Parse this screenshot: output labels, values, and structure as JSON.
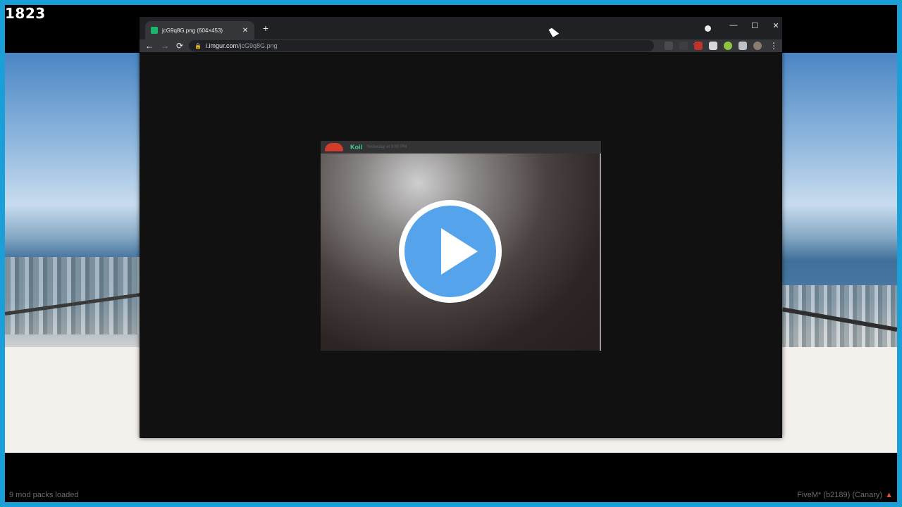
{
  "overlay": {
    "counter": "1823",
    "status_left": "9 mod packs loaded",
    "status_right": "FiveM* (b2189) (Canary)"
  },
  "browser": {
    "tab": {
      "title": "jcG9q8G.png (604×453)",
      "close_glyph": "✕"
    },
    "newtab_glyph": "+",
    "window_controls": {
      "minimize": "—",
      "maximize": "☐",
      "close": "✕"
    },
    "nav": {
      "back": "←",
      "forward": "→",
      "reload": "⟳"
    },
    "url": {
      "host": "i.imgur.com",
      "path": "/jcG9q8G.png"
    },
    "bookmark_glyph": "☆",
    "menu_glyph": "⋮",
    "extension_icons": [
      "glasses-icon",
      "scissors-icon",
      "ublock-icon",
      "clip-icon",
      "gauge-icon",
      "puzzle-icon",
      "avatar-icon"
    ]
  },
  "image_card": {
    "username": "Koil",
    "timestamp": "Yesterday at 9:00 PM",
    "play_icon": "play-icon"
  }
}
